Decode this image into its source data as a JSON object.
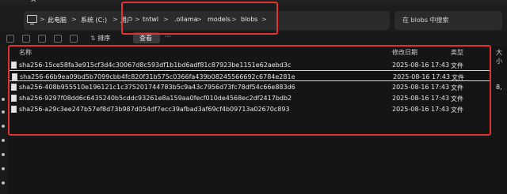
{
  "window": {
    "close_glyph": "✕"
  },
  "nav": {
    "back": "←",
    "forward": "→",
    "up": "↑",
    "refresh": "⟳"
  },
  "breadcrumb": [
    "此电脑",
    "系统 (C:)",
    "用户",
    "tntwl",
    ".ollama",
    "models",
    "blobs"
  ],
  "breadcrumb_separator": ">",
  "search": {
    "placeholder": "在 blobs 中搜索"
  },
  "toolbar": {
    "sort_label": "排序",
    "view_label": "查看",
    "more_label": "···"
  },
  "columns": {
    "name": "名称",
    "modified": "修改日期",
    "type": "类型",
    "size": "大小"
  },
  "files": [
    {
      "name": "sha256-15ce58fa3e915cf3d4c30067d8c593df1b1bd6adf81c87923be1151e62aebd3c",
      "modified": "2025-08-16 17:43",
      "type": "文件",
      "size": ""
    },
    {
      "name": "sha256-66b9ea09bd5b7099cbb4fc820f31b575c0366fa439b08245566692c6784e281e",
      "modified": "2025-08-16 17:43",
      "type": "文件",
      "size": ""
    },
    {
      "name": "sha256-408b955510e196121c1c375201744783b5c9a43c7956d73fc78df54c66e883d6",
      "modified": "2025-08-16 17:43",
      "type": "文件",
      "size": "8,"
    },
    {
      "name": "sha256-9297f08dd6c6435240b5cddc93261e8a159aa0fecf010de4568ec2df2417bdb2",
      "modified": "2025-08-16 17:43",
      "type": "文件",
      "size": ""
    },
    {
      "name": "sha256-a29c3ee247b57ef8d73b987d054df7ecc39afbad3af69cf4b09713a02670c893",
      "modified": "2025-08-16 17:43",
      "type": "文件",
      "size": ""
    }
  ],
  "colors": {
    "annotation": "#e03232",
    "background": "#191919"
  }
}
